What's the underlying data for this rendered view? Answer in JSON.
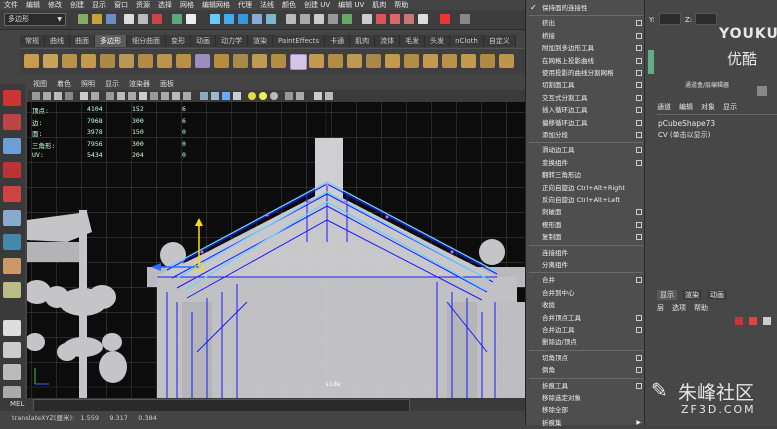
{
  "menubar": [
    "文件",
    "编辑",
    "修改",
    "创建",
    "显示",
    "窗口",
    "资源",
    "选择",
    "网格",
    "编辑网格",
    "代理",
    "法线",
    "颜色",
    "创建 UV",
    "编辑 UV",
    "肌肉",
    "帮助"
  ],
  "statusline": {
    "mode": "多边形"
  },
  "shelf_tabs": [
    "常规",
    "曲线",
    "曲面",
    "多边形",
    "细分曲面",
    "变形",
    "动画",
    "动力学",
    "渲染",
    "PaintEffects",
    "卡通",
    "肌肉",
    "流体",
    "毛发",
    "头发",
    "nCloth",
    "自定义"
  ],
  "active_shelf_tab": "多边形",
  "panel_menu": [
    "视图",
    "着色",
    "照明",
    "显示",
    "渲染器",
    "面板"
  ],
  "hud": [
    {
      "label": "顶点:",
      "v1": "4104",
      "v2": "152",
      "v3": "6"
    },
    {
      "label": "边:",
      "v1": "7968",
      "v2": "300",
      "v3": "6"
    },
    {
      "label": "面:",
      "v1": "3978",
      "v2": "150",
      "v3": "0"
    },
    {
      "label": "三角形:",
      "v1": "7956",
      "v2": "300",
      "v3": "0"
    },
    {
      "label": "UV:",
      "v1": "5434",
      "v2": "204",
      "v3": "0"
    }
  ],
  "viewport": {
    "camera_label": "side"
  },
  "mel": {
    "label": "MEL"
  },
  "helpline": {
    "text": "translateXYZ(厘米):   1.559     9.317     0.384"
  },
  "context_menu": [
    {
      "label": "保持面的连接性",
      "check": true
    },
    {
      "sep": true
    },
    {
      "label": "挤出",
      "box": true
    },
    {
      "label": "桥接",
      "box": true
    },
    {
      "label": "附加到多边形工具",
      "box": true
    },
    {
      "label": "在网格上投影曲线",
      "box": true
    },
    {
      "label": "使用投影的曲线分割网格",
      "box": true
    },
    {
      "label": "切割面工具",
      "box": true
    },
    {
      "label": "交互式分割工具",
      "box": true
    },
    {
      "label": "插入循环边工具",
      "box": true
    },
    {
      "label": "偏移循环边工具",
      "box": true
    },
    {
      "label": "添加分段",
      "box": true
    },
    {
      "sep": true
    },
    {
      "label": "滑动边工具",
      "box": true
    },
    {
      "label": "变换组件",
      "box": true
    },
    {
      "label": "翻转三角形边"
    },
    {
      "label": "正向自旋边 Ctrl+Alt+Right"
    },
    {
      "label": "反向自旋边  Ctrl+Alt+Left"
    },
    {
      "label": "刺破面",
      "box": true
    },
    {
      "label": "楔形面",
      "box": true
    },
    {
      "label": "复制面",
      "box": true
    },
    {
      "sep": true
    },
    {
      "label": "连接组件"
    },
    {
      "label": "分离组件"
    },
    {
      "sep": true
    },
    {
      "label": "合并",
      "box": true
    },
    {
      "label": "合并到中心"
    },
    {
      "label": "收拢"
    },
    {
      "label": "合并顶点工具",
      "box": true
    },
    {
      "label": "合并边工具",
      "box": true
    },
    {
      "label": "删除边/顶点"
    },
    {
      "sep": true
    },
    {
      "label": "切角顶点",
      "box": true
    },
    {
      "label": "倒角",
      "box": true
    },
    {
      "sep": true
    },
    {
      "label": "折痕工具",
      "box": true
    },
    {
      "label": "移除选定对象"
    },
    {
      "label": "移除全部"
    },
    {
      "label": "折痕集",
      "arrow": true
    }
  ],
  "right_panel": {
    "y_label": "Y:",
    "z_label": "Z:",
    "channel_header": "通道盒/层编辑器",
    "tabs": [
      "通道",
      "编辑",
      "对象",
      "显示"
    ],
    "object_name": "pCubeShape73",
    "cv_text": "CV (单击以显示)",
    "layer_tabs": [
      "显示",
      "渲染",
      "动画"
    ],
    "layer_menu": [
      "层",
      "选项",
      "帮助"
    ]
  },
  "watermark": {
    "youku_en": "YOUKU",
    "youku_cn": "优酷",
    "site_cn": "朱峰社区",
    "site_url": "ZF3D.COM"
  },
  "colors": {
    "selection_blue": "#6ad0ff",
    "wire_blue": "#1a1aff",
    "model_grey": "#cfcfd2",
    "menu_bg": "#4e4e4e"
  }
}
